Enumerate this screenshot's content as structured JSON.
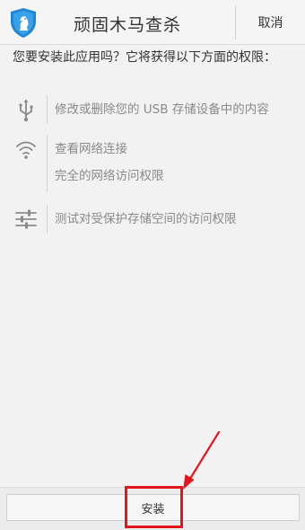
{
  "header": {
    "app_title": "顽固木马查杀",
    "cancel_label": "取消",
    "app_icon": "shield-knight-icon"
  },
  "question": {
    "text": "您要安装此应用吗？它将获得以下方面的权限："
  },
  "permissions": [
    {
      "icon": "usb-icon",
      "lines": [
        "修改或删除您的 USB 存储设备中的内容"
      ]
    },
    {
      "icon": "wifi-icon",
      "lines": [
        "查看网络连接",
        "完全的网络访问权限"
      ]
    },
    {
      "icon": "sliders-icon",
      "lines": [
        "测试对受保护存储空间的访问权限"
      ]
    }
  ],
  "footer": {
    "install_label": "安装"
  },
  "colors": {
    "accent_blue": "#1f86d6",
    "highlight_red": "#e4161b",
    "background": "#f2f2f2"
  }
}
